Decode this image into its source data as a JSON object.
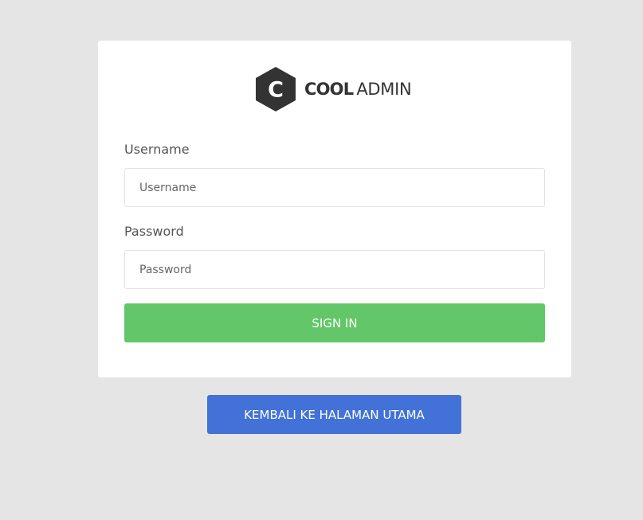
{
  "logo": {
    "icon": "hexagon-c-icon",
    "letter": "C",
    "text_bold": "COOL",
    "text_light": "ADMIN"
  },
  "form": {
    "username": {
      "label": "Username",
      "placeholder": "Username",
      "value": ""
    },
    "password": {
      "label": "Password",
      "placeholder": "Password",
      "value": ""
    },
    "submit_label": "SIGN IN"
  },
  "back_button_label": "KEMBALI KE HALAMAN UTAMA",
  "colors": {
    "background": "#e5e5e5",
    "card": "#ffffff",
    "signin_button": "#63c76a",
    "back_button": "#4272d7",
    "logo": "#333333"
  }
}
